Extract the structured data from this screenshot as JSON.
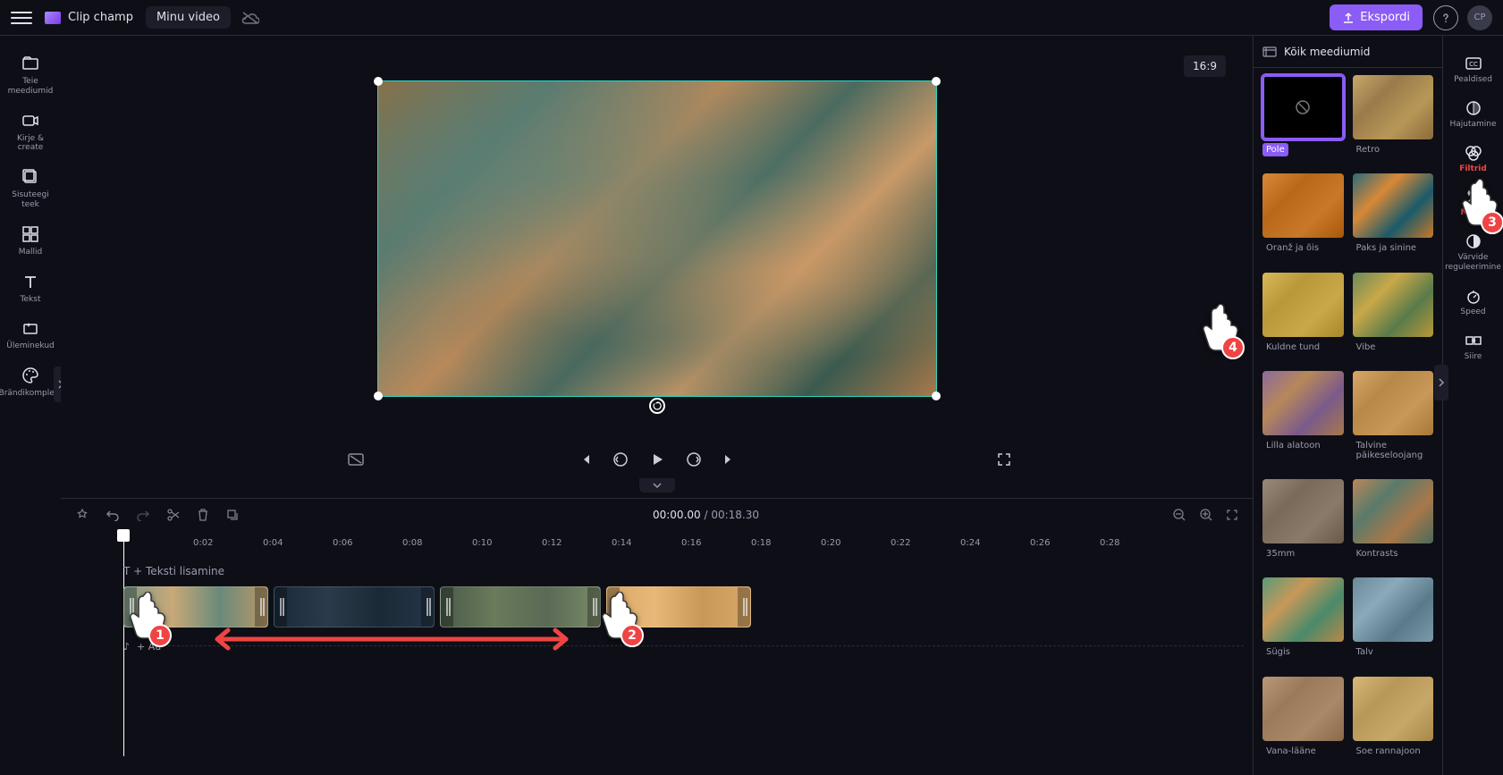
{
  "header": {
    "brand": "Clip champ",
    "title": "Minu video",
    "export": "Ekspordi",
    "avatar": "CP"
  },
  "leftRail": [
    {
      "icon": "folder",
      "label": "Teie meediumid"
    },
    {
      "icon": "camera",
      "label": "Kirje &amp; create"
    },
    {
      "icon": "library",
      "label": "Sisuteegi teek"
    },
    {
      "icon": "grid",
      "label": "Mallid"
    },
    {
      "icon": "text",
      "label": "Tekst"
    },
    {
      "icon": "sparkle",
      "label": "Üleminekud"
    },
    {
      "icon": "palette",
      "label": "Brändikomplekt"
    }
  ],
  "aspect": "16:9",
  "time": {
    "current": "00:00.00",
    "duration": "00:18.30"
  },
  "ruler": [
    "0:02",
    "0:04",
    "0:06",
    "0:08",
    "0:10",
    "0:12",
    "0:14",
    "0:16",
    "0:18",
    "0:20",
    "0:22",
    "0:24",
    "0:26",
    "0:28"
  ],
  "textHint": "T + Teksti lisamine",
  "audioHint": "+ Au",
  "rightPanel": {
    "header": "Kõik meediumid",
    "filters": [
      {
        "name": "Pole",
        "variant": "none",
        "selected": true
      },
      {
        "name": "Retro",
        "variant": "ft-retro"
      },
      {
        "name": "Oranž ja õis",
        "variant": "ft-orange"
      },
      {
        "name": "Paks ja sinine",
        "variant": "ft-teal"
      },
      {
        "name": "Kuldne tund",
        "variant": "ft-gold"
      },
      {
        "name": "Vibe",
        "variant": "ft-vibe"
      },
      {
        "name": "Lilla alatoon",
        "variant": "ft-lilac"
      },
      {
        "name": "Talvine päikeseloojang",
        "variant": "ft-winter"
      },
      {
        "name": "35mm",
        "variant": "ft-35mm"
      },
      {
        "name": "Kontrasts",
        "variant": "ft-contrast"
      },
      {
        "name": "Sügis",
        "variant": "ft-autumn"
      },
      {
        "name": "Talv",
        "variant": "ft-winter2"
      },
      {
        "name": "Vana-lääne",
        "variant": "ft-old"
      },
      {
        "name": "Soe rannajoon",
        "variant": "ft-beach"
      }
    ]
  },
  "propRail": [
    {
      "icon": "cc",
      "label": "Pealdised"
    },
    {
      "icon": "fade",
      "label": "Hajutamine"
    },
    {
      "icon": "filter",
      "label": "Filtrid",
      "hl": true
    },
    {
      "icon": "wand",
      "label": "Mõud",
      "hl": true
    },
    {
      "icon": "contrast",
      "label": "Värvide reguleerimine"
    },
    {
      "icon": "speed",
      "label": "Speed"
    },
    {
      "icon": "transition",
      "label": "Siire"
    }
  ]
}
